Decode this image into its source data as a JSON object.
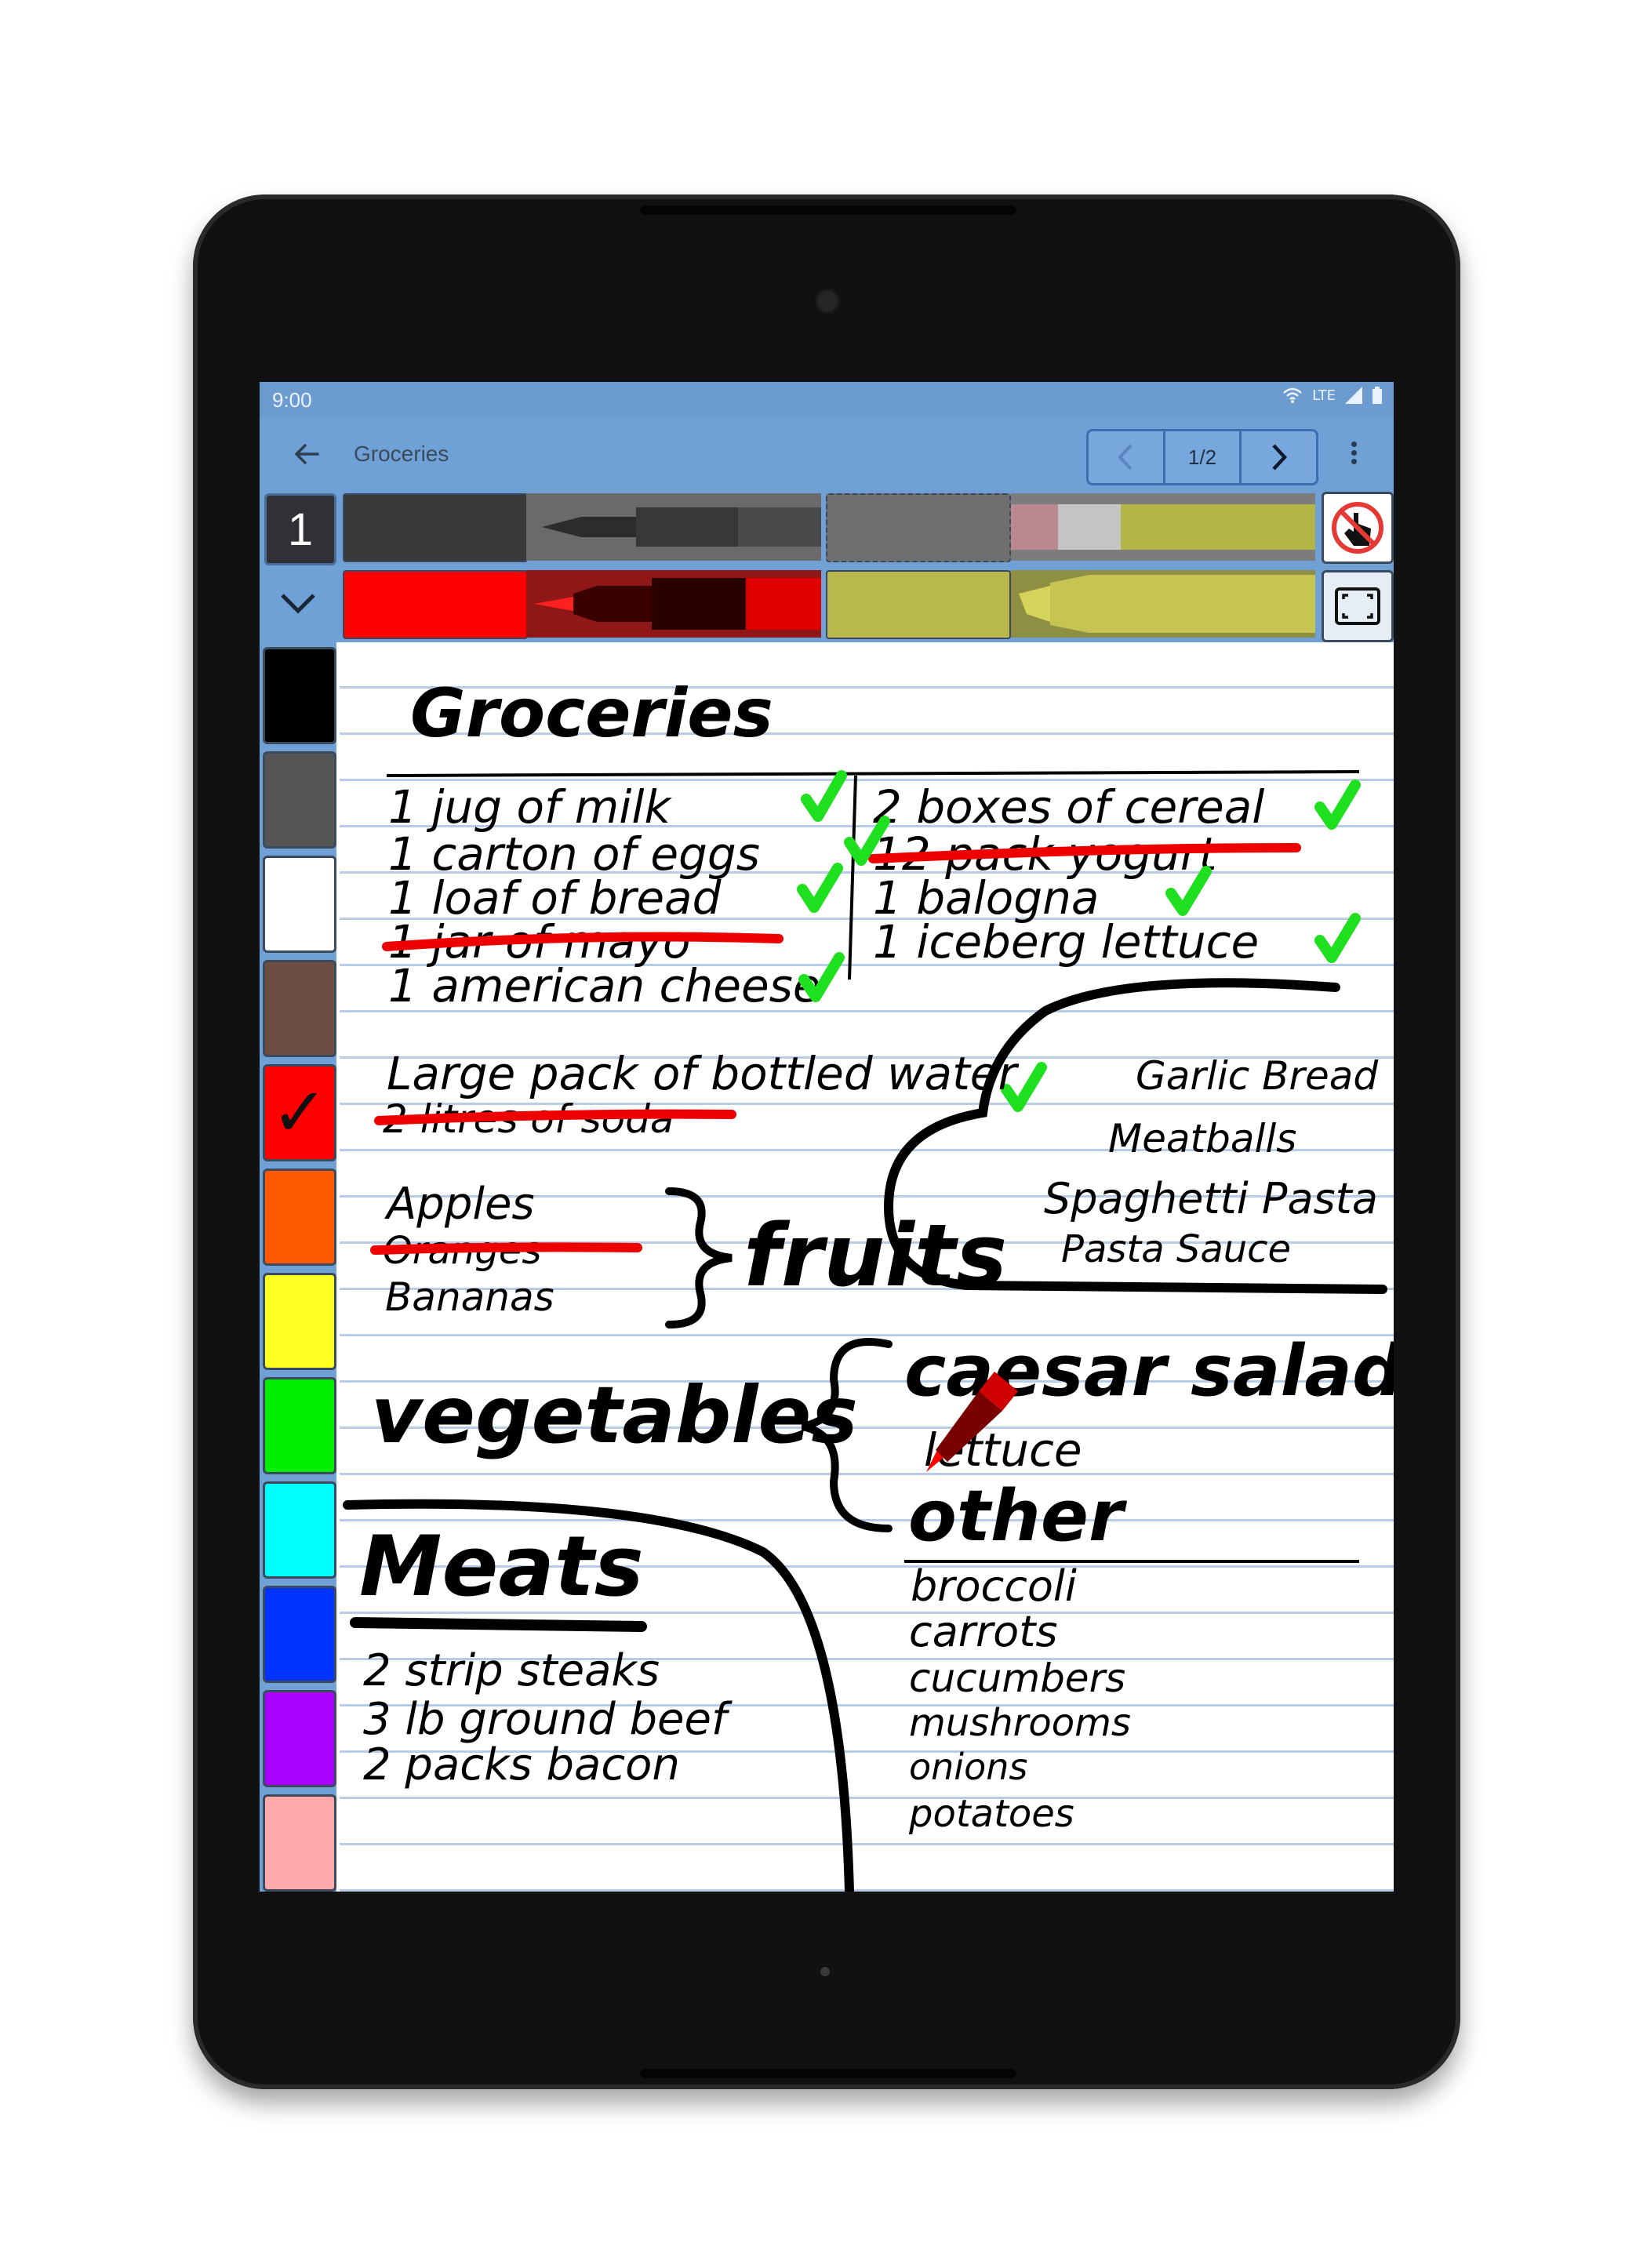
{
  "status": {
    "time": "9:00",
    "network": "LTE"
  },
  "appbar": {
    "title": "Groceries",
    "page_indicator": "1/2"
  },
  "toolbar": {
    "pen_number": "1",
    "pens": [
      {
        "color": "#3a3a3a",
        "type": "marker"
      },
      {
        "color": "#6f6f6f",
        "type": "eraser"
      },
      {
        "color": "#ff0000",
        "type": "marker",
        "selected": true
      },
      {
        "color": "#b8b84a",
        "type": "highlighter"
      }
    ],
    "icons": [
      "no-touch-icon",
      "fit-screen-icon"
    ]
  },
  "palette": {
    "colors": [
      "#000000",
      "#555555",
      "#ffffff",
      "#6d4c41",
      "#ff0000",
      "#ff5a00",
      "#ffff22",
      "#00ee00",
      "#00ffff",
      "#0033ff",
      "#aa00ff",
      "#ffaaaa"
    ],
    "selected_index": 4,
    "check_glyph": "✓"
  },
  "note": {
    "title": "Groceries",
    "list_left": [
      "1 jug of milk",
      "1 carton of eggs",
      "1 loaf of bread",
      "1 jar of mayo",
      "1 american cheese"
    ],
    "list_right": [
      "2 boxes of cereal",
      "12 pack yogurt",
      "1 balogna",
      "1 iceberg lettuce"
    ],
    "water": "Large pack of bottled water",
    "soda": "2 litres of soda",
    "fruits_items": [
      "Apples",
      "Oranges",
      "Bananas"
    ],
    "fruits_label": "fruits",
    "italian": [
      "Garlic Bread",
      "Meatballs",
      "Spaghetti Pasta",
      "Pasta Sauce"
    ],
    "vegetables_label": "vegetables",
    "caesar": "caesar salad",
    "lettuce": "lettuce",
    "other_label": "other",
    "other_items": [
      "broccoli",
      "carrots",
      "cucumbers",
      "mushrooms",
      "onions",
      "potatoes"
    ],
    "meats_label": "Meats",
    "meats_items": [
      "2 strip steaks",
      "3 lb ground beef",
      "2 packs bacon"
    ]
  }
}
